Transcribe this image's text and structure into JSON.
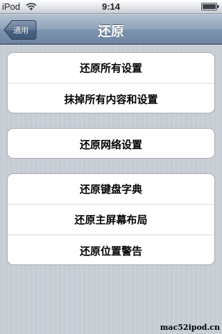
{
  "status_bar": {
    "carrier": "iPod",
    "time": "9:14"
  },
  "nav": {
    "back_label": "通用",
    "title": "还原"
  },
  "groups": [
    {
      "rows": [
        "还原所有设置",
        "抹掉所有内容和设置"
      ]
    },
    {
      "rows": [
        "还原网络设置"
      ]
    },
    {
      "rows": [
        "还原键盘字典",
        "还原主屏幕布局",
        "还原位置警告"
      ]
    }
  ],
  "watermark": "mac52ipod.cn",
  "colors": {
    "background": "#c5ccd4",
    "nav_bar": "#6d84a2"
  },
  "icons": [
    "wifi-icon",
    "battery-icon"
  ]
}
